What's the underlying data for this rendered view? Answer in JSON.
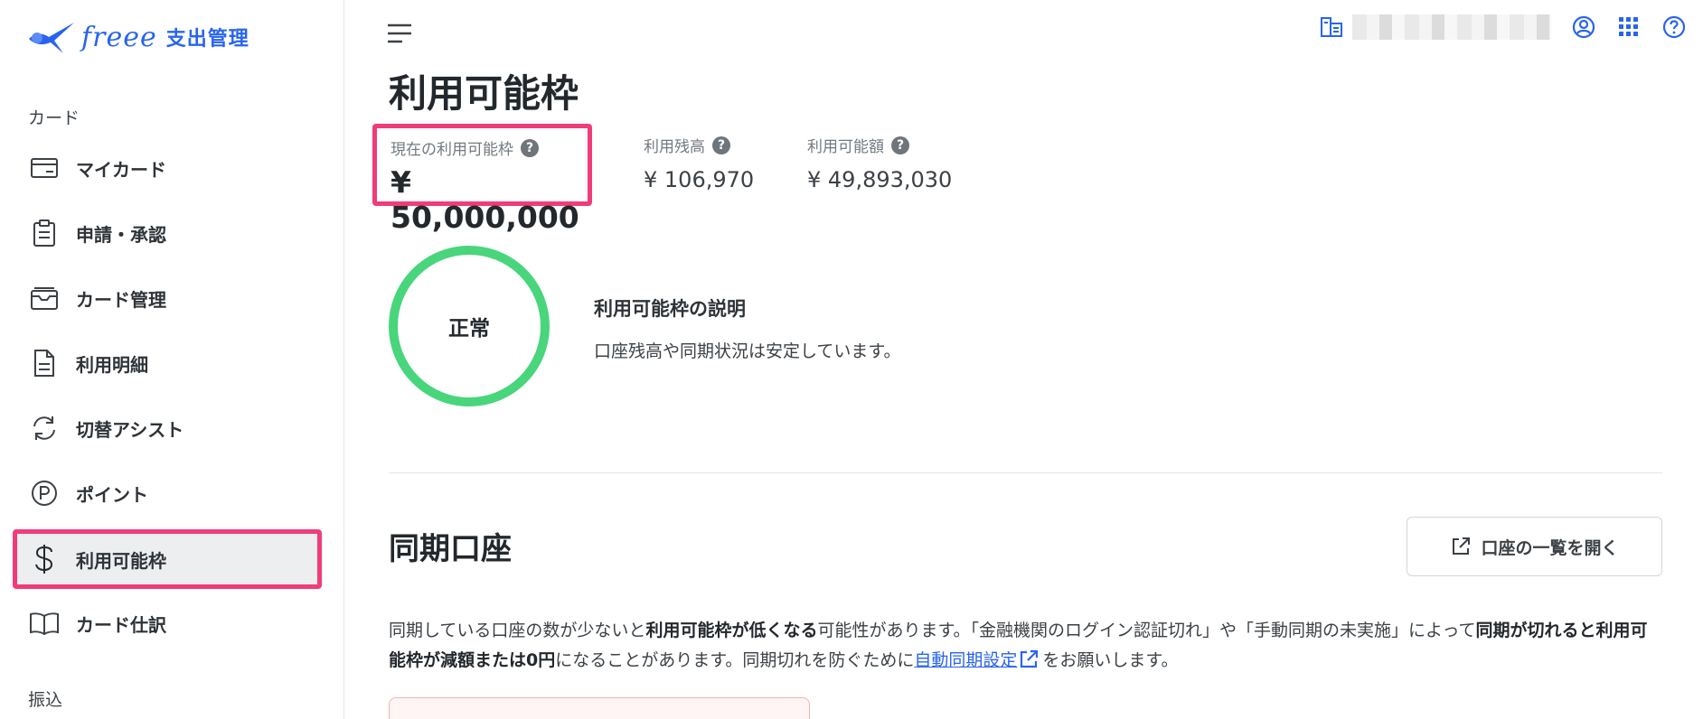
{
  "brand": {
    "wordmark": "freee",
    "product": "支出管理"
  },
  "sidebar": {
    "section_card": "カード",
    "items": [
      {
        "label": "マイカード",
        "icon": "card-icon"
      },
      {
        "label": "申請・承認",
        "icon": "clipboard-icon"
      },
      {
        "label": "カード管理",
        "icon": "card-stack-icon"
      },
      {
        "label": "利用明細",
        "icon": "document-icon"
      },
      {
        "label": "切替アシスト",
        "icon": "refresh-icon"
      },
      {
        "label": "ポイント",
        "icon": "point-icon"
      },
      {
        "label": "利用可能枠",
        "icon": "dollar-icon",
        "active": true
      },
      {
        "label": "カード仕訳",
        "icon": "book-icon"
      }
    ],
    "section_transfer": "振込"
  },
  "header": {
    "company_name": ""
  },
  "page": {
    "title": "利用可能枠",
    "stats": {
      "current_limit": {
        "label": "現在の利用可能枠",
        "value": "¥ 50,000,000"
      },
      "balance": {
        "label": "利用残高",
        "value": "¥ 106,970"
      },
      "available": {
        "label": "利用可能額",
        "value": "¥ 49,893,030"
      }
    },
    "status": {
      "text": "正常",
      "explain_title": "利用可能枠の説明",
      "explain_text": "口座残高や同期状況は安定しています。"
    },
    "sync": {
      "title": "同期口座",
      "open_button": "口座の一覧を開く",
      "notice": {
        "t1": "同期している口座の数が少ないと",
        "b1": "利用可能枠が低くなる",
        "t2": "可能性があります。「金融機関のログイン認証切れ」や「手動同期の未実施」によって",
        "b2": "同期が切れると利用可能枠が減額または0円",
        "t3": "になることがあります。同期切れを防ぐために",
        "link": "自動同期設定",
        "t4": "をお願いします。"
      }
    }
  },
  "colors": {
    "accent": "#2864f0",
    "highlight": "#f03c78",
    "status_ok": "#49d57c"
  }
}
